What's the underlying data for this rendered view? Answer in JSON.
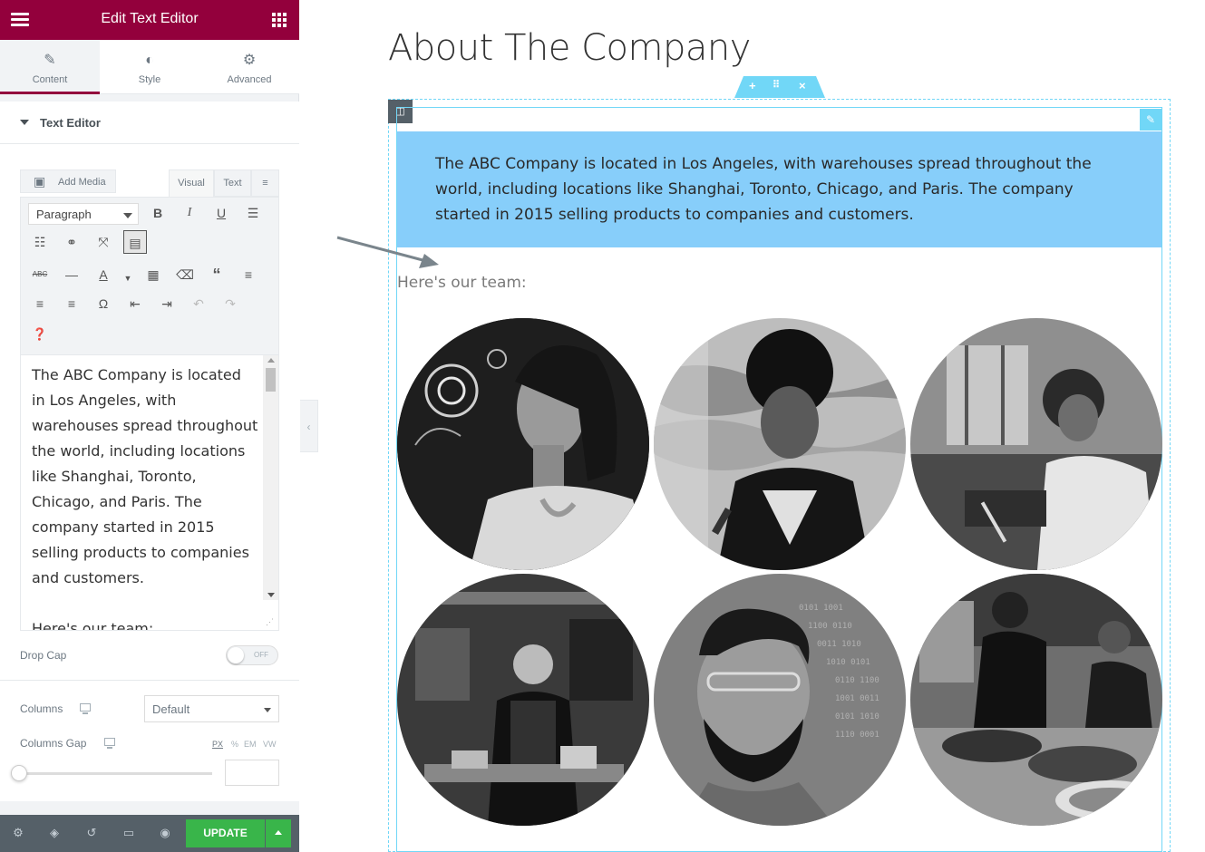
{
  "panel": {
    "title": "Edit Text Editor",
    "tabs": [
      {
        "label": "Content",
        "icon": "pencil-icon"
      },
      {
        "label": "Style",
        "icon": "half-circle-icon"
      },
      {
        "label": "Advanced",
        "icon": "gear-icon"
      }
    ],
    "section": "Text Editor",
    "add_media": "Add Media",
    "editor_tabs": {
      "visual": "Visual",
      "text": "Text"
    },
    "format_select": "Paragraph",
    "editor_paragraphs": [
      "The ABC Company is located in Los Angeles, with warehouses spread throughout the world, including locations like Shanghai, Toronto, Chicago, and Paris. The company started in 2015 selling products to companies and customers.",
      "Here's our team:"
    ],
    "drop_cap": {
      "label": "Drop Cap",
      "state": "OFF"
    },
    "columns": {
      "label": "Columns",
      "value": "Default"
    },
    "columns_gap": {
      "label": "Columns Gap",
      "units": [
        "PX",
        "%",
        "EM",
        "VW"
      ],
      "selected_unit": "PX"
    },
    "footer": {
      "update": "UPDATE"
    }
  },
  "preview": {
    "title": "About The Company",
    "highlight_text": "The ABC Company is located in Los Angeles, with warehouses spread throughout the world, including locations like Shanghai, Toronto, Chicago, and Paris. The company started in 2015 selling products to companies and customers.",
    "team_heading": "Here's our team:",
    "team_photos": [
      "woman-with-holographic-lights",
      "woman-on-phone-writing",
      "man-writing-at-desk",
      "chef-in-kitchen",
      "bearded-man-with-code-projection",
      "chefs-plating-food"
    ]
  },
  "colors": {
    "header": "#93003c",
    "highlight": "#87cefa",
    "frame": "#71d7f7",
    "update_button": "#39b54a",
    "footer": "#556068"
  }
}
